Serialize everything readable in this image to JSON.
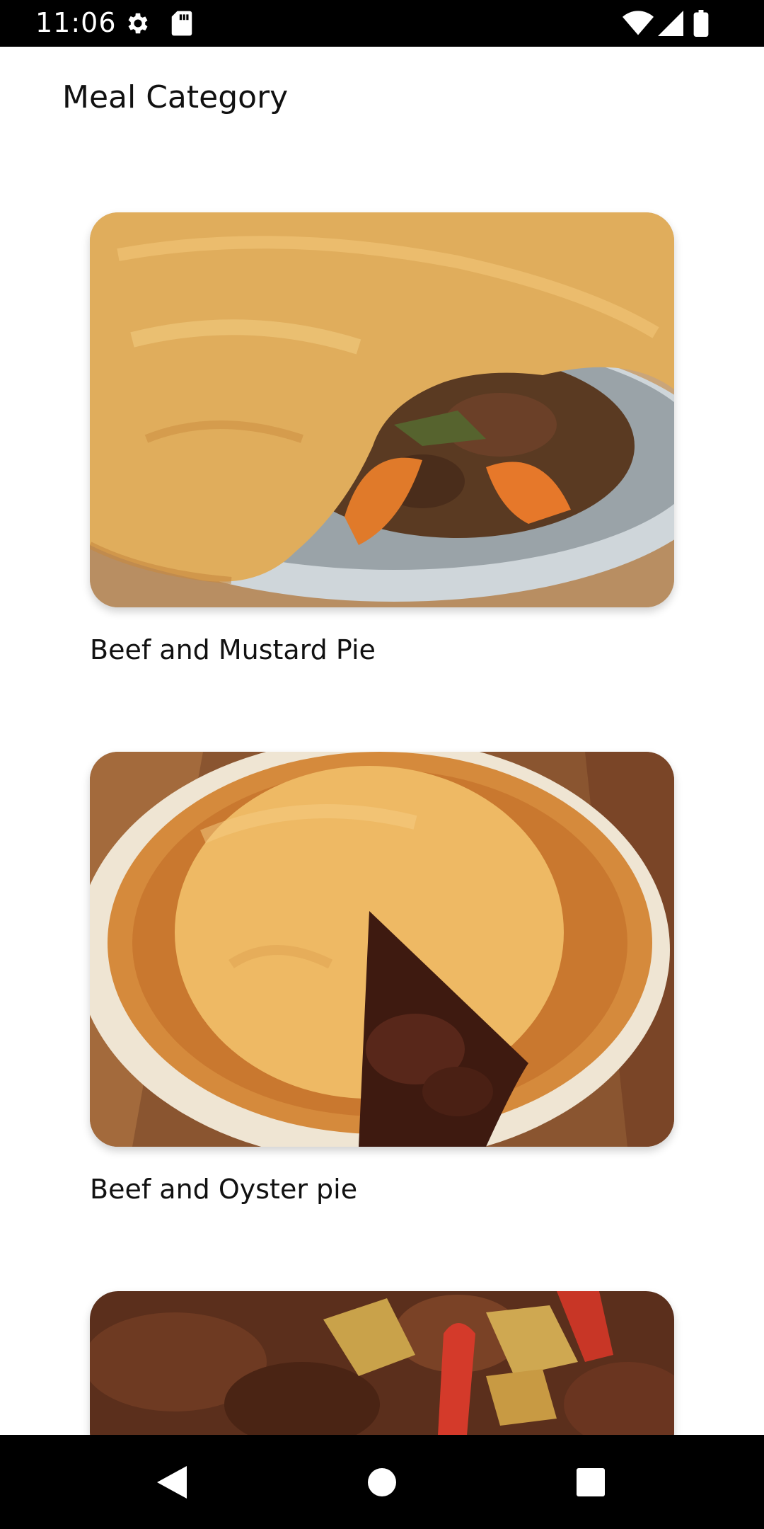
{
  "status_bar": {
    "time": "11:06",
    "icons": [
      "settings-icon",
      "sd-card-icon",
      "wifi-icon",
      "signal-icon",
      "battery-icon"
    ]
  },
  "header": {
    "title": "Meal Category"
  },
  "meals": [
    {
      "name": "Beef and Mustard Pie",
      "image": "beef-mustard-pie-photo"
    },
    {
      "name": "Beef and Oyster pie",
      "image": "beef-oyster-pie-photo"
    },
    {
      "name": "",
      "image": "beef-stew-photo"
    }
  ],
  "nav_bar": {
    "buttons": [
      "back-icon",
      "home-icon",
      "recents-icon"
    ]
  },
  "colors": {
    "system_bars": "#000000",
    "background": "#ffffff",
    "text": "#111111"
  }
}
